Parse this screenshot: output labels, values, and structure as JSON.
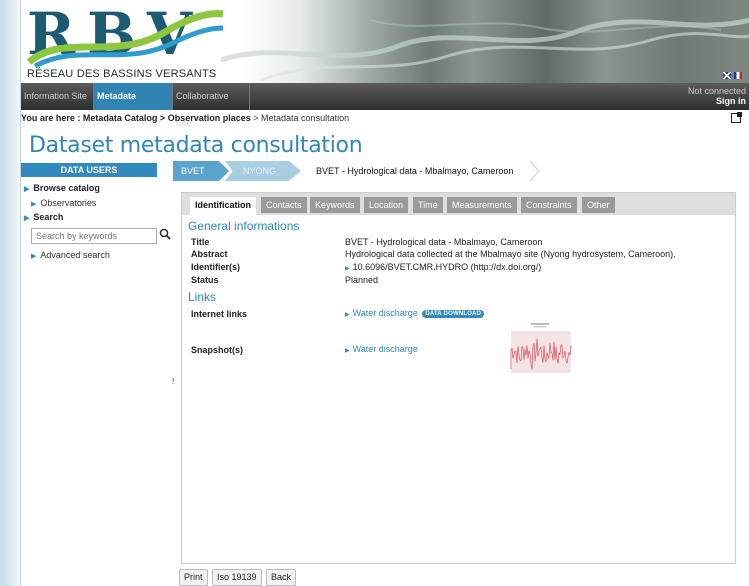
{
  "header": {
    "logo_text": "RBV",
    "subtitle": "RÉSEAU DES BASSINS VERSANTS"
  },
  "nav": {
    "tabs": [
      {
        "label": "Information Site"
      },
      {
        "label": "Metadata Catalog"
      },
      {
        "label": "Collaborative Site"
      }
    ],
    "status": "Not connected",
    "signin": "Sign in"
  },
  "breadcrumb": {
    "prefix": "You are here :",
    "part1": "Metadata Catalog",
    "sep": ">",
    "part2": "Observation places",
    "current": "Metadata consultation"
  },
  "page_title": "Dataset metadata consultation",
  "sidebar": {
    "header": "DATA USERS",
    "browse": "Browse catalog",
    "observatories": "Observatories",
    "search": "Search",
    "search_placeholder": "Search by keywords",
    "advanced": "Advanced search",
    "marker": "!"
  },
  "dataset_path": {
    "level1": "BVET",
    "level2": "NYONG",
    "title": "BVET - Hydrological data - Mbalmayo, Cameroon"
  },
  "tabs": [
    "Identification",
    "Contacts",
    "Keywords",
    "Location",
    "Time",
    "Measurements",
    "Constraints",
    "Other"
  ],
  "general": {
    "heading": "General informations",
    "title_label": "Title",
    "title_value": "BVET - Hydrological data - Mbalmayo, Cameroon",
    "abstract_label": "Abstract",
    "abstract_value": "Hydrological data collected at the Mbalmayo site (Nyong hydrosystem, Cameroon).",
    "identifier_label": "Identifier(s)",
    "identifier_value": "10.6096/BVET.CMR.HYDRO (http://dx.doi.org/)",
    "status_label": "Status",
    "status_value": "Planned"
  },
  "links": {
    "heading": "Links",
    "internet_label": "Internet links",
    "internet_value": "Water discharge",
    "download_badge": "DATA DOWNLOAD",
    "snapshot_label": "Snapshot(s)",
    "snapshot_value": "Water discharge"
  },
  "buttons": {
    "print": "Print",
    "iso": "Iso 19139",
    "back": "Back"
  },
  "colors": {
    "accent": "#2e87b8",
    "nav_active": "#2f84b4"
  }
}
